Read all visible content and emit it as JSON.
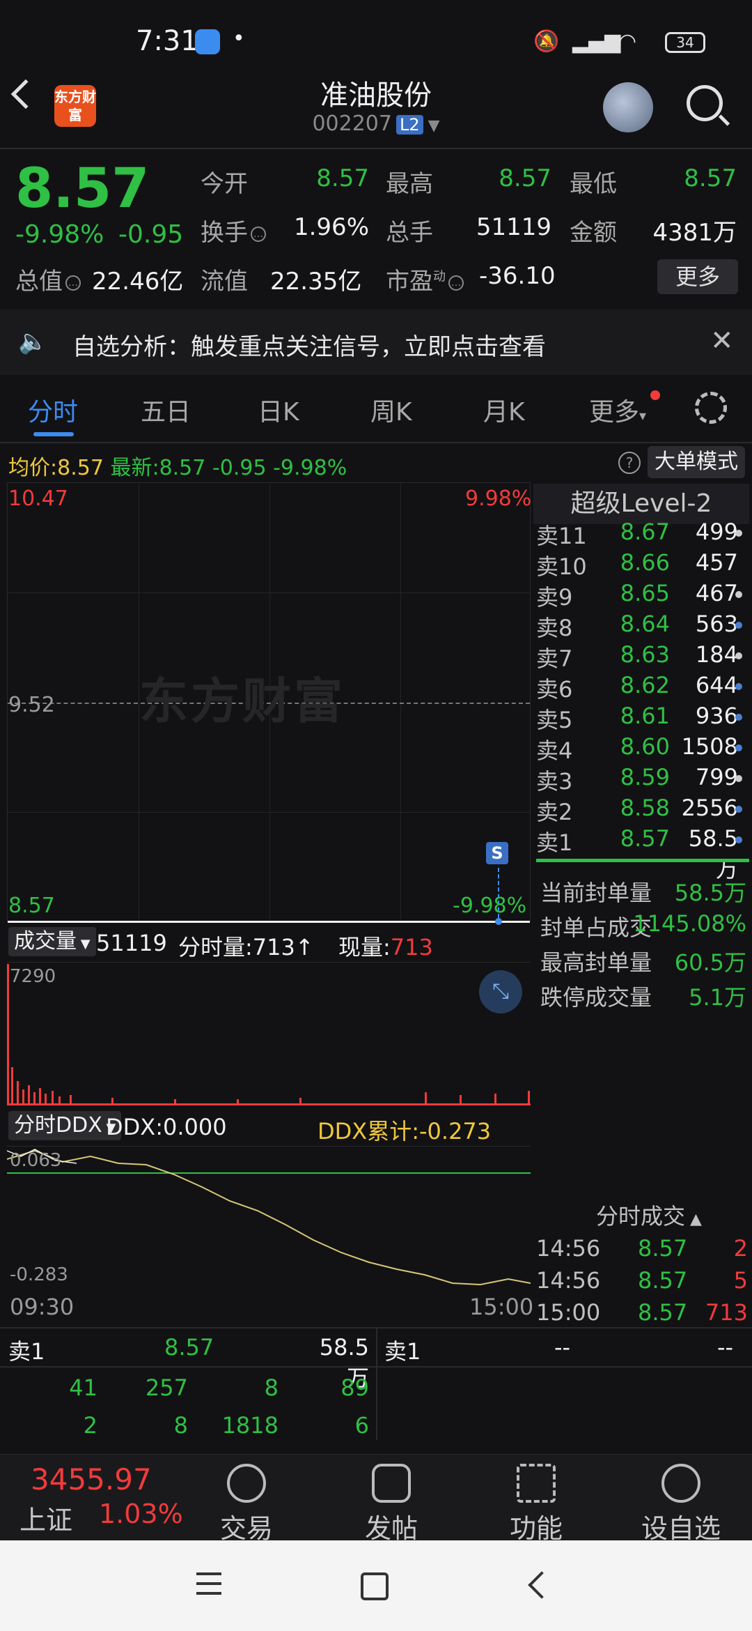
{
  "status": {
    "time": "7:31",
    "battery": "34"
  },
  "header": {
    "logo_text": "东方财富",
    "name": "准油股份",
    "code": "002207",
    "level_badge": "L2"
  },
  "quote": {
    "price": "8.57",
    "change_pct": "-9.98%",
    "change": "-0.95",
    "open_label": "今开",
    "open": "8.57",
    "high_label": "最高",
    "high": "8.57",
    "low_label": "最低",
    "low": "8.57",
    "turnover_label": "换手",
    "turnover": "1.96%",
    "volume_label": "总手",
    "volume": "51119",
    "amount_label": "金额",
    "amount": "4381万",
    "mktcap_label": "总值",
    "mktcap": "22.46亿",
    "float_label": "流值",
    "float": "22.35亿",
    "pe_label": "市盈",
    "pe_sup": "动",
    "pe": "-36.10",
    "more": "更多"
  },
  "notice": {
    "text": "自选分析：触发重点关注信号，立即点击查看"
  },
  "tabs": [
    "分时",
    "五日",
    "日K",
    "周K",
    "月K",
    "更多"
  ],
  "avg_row": {
    "avg_label": "均价:",
    "avg": "8.57",
    "latest_label": "最新:",
    "latest": "8.57",
    "change": "-0.95",
    "change_pct": "-9.98%",
    "big_order": "大单模式"
  },
  "chart": {
    "y_top": "10.47",
    "y_mid": "9.52",
    "y_bot": "8.57",
    "pct_top": "9.98%",
    "pct_bot": "-9.98%",
    "watermark": "东方财富",
    "s_badge": "S"
  },
  "volume": {
    "label": "成交量",
    "total": "51119",
    "period_label": "分时量:",
    "period": "713↑",
    "now_label": "现量:",
    "now": "713",
    "y_top": "7290"
  },
  "ddx": {
    "label": "分时DDX",
    "ddx": "DDX:0.000",
    "cum": "DDX累计:-0.273",
    "y_top": "0.063",
    "y_bot": "-0.283",
    "x_start": "09:30",
    "x_end": "15:00"
  },
  "book": {
    "title": "超级Level-2",
    "rows": [
      {
        "label": "卖11",
        "price": "8.67",
        "qty": "499",
        "dot": "#cccccc"
      },
      {
        "label": "卖10",
        "price": "8.66",
        "qty": "457",
        "dot": ""
      },
      {
        "label": "卖9",
        "price": "8.65",
        "qty": "467",
        "dot": "#cccccc"
      },
      {
        "label": "卖8",
        "price": "8.64",
        "qty": "563",
        "dot": "#4a7fd0"
      },
      {
        "label": "卖7",
        "price": "8.63",
        "qty": "184",
        "dot": "#cccccc"
      },
      {
        "label": "卖6",
        "price": "8.62",
        "qty": "644",
        "dot": "#4a7fd0"
      },
      {
        "label": "卖5",
        "price": "8.61",
        "qty": "936",
        "dot": "#4a7fd0"
      },
      {
        "label": "卖4",
        "price": "8.60",
        "qty": "1508",
        "dot": "#4a7fd0"
      },
      {
        "label": "卖3",
        "price": "8.59",
        "qty": "799",
        "dot": "#cccccc"
      },
      {
        "label": "卖2",
        "price": "8.58",
        "qty": "2556",
        "dot": "#4a7fd0"
      },
      {
        "label": "卖1",
        "price": "8.57",
        "qty": "58.5万",
        "dot": "#4a7fd0"
      }
    ],
    "stats": [
      {
        "label": "当前封单量",
        "value": "58.5万"
      },
      {
        "label": "封单占成交",
        "value": "1145.08%"
      },
      {
        "label": "最高封单量",
        "value": "60.5万"
      },
      {
        "label": "跌停成交量",
        "value": "5.1万"
      }
    ]
  },
  "trades": {
    "title": "分时成交",
    "rows": [
      {
        "time": "14:56",
        "price": "8.57",
        "vol": "2"
      },
      {
        "time": "14:56",
        "price": "8.57",
        "vol": "5"
      },
      {
        "time": "15:00",
        "price": "8.57",
        "vol": "713"
      }
    ]
  },
  "bottom_table": {
    "left_label": "卖1",
    "left_price": "8.57",
    "left_qty": "58.5万",
    "right_label": "卖1",
    "right_price": "--",
    "right_qty": "--",
    "row1": [
      "41",
      "257",
      "8",
      "89"
    ],
    "row2": [
      "2",
      "8",
      "1818",
      "6"
    ]
  },
  "bottom_nav": {
    "index_price": "3455.97",
    "index_name": "上证",
    "index_chg": "1.03%",
    "items": [
      "交易",
      "发帖",
      "功能",
      "设自选"
    ]
  },
  "colors": {
    "up": "#f23b3b",
    "down": "#2fc045",
    "accent": "#3c8cf0",
    "avg": "#f0c83c"
  },
  "chart_data": {
    "type": "line",
    "title": "",
    "x": [
      "09:30",
      "15:00"
    ],
    "ylim": [
      8.57,
      10.47
    ],
    "series": [
      {
        "values": [
          8.57,
          8.57
        ]
      }
    ]
  }
}
